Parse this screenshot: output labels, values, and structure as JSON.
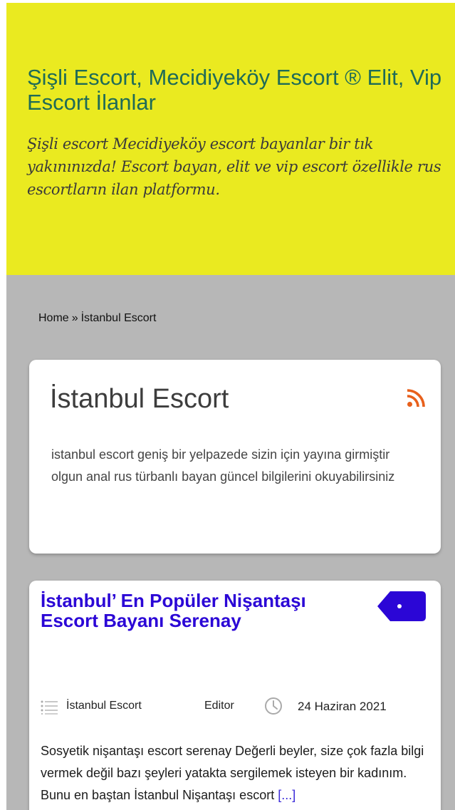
{
  "header": {
    "title": "Şişli Escort, Mecidiyeköy Escort ® Elit, Vip Escort İlanlar",
    "description": "Şişli escort Mecidiyeköy escort bayanlar bir tık yakınınızda! Escort bayan, elit ve vip escort özellikle rus escortların ilan platformu."
  },
  "breadcrumb": {
    "home": "Home",
    "separator": "»",
    "current": "İstanbul Escort"
  },
  "category": {
    "title": "İstanbul Escort",
    "description": "istanbul escort geniş bir yelpazede sizin için yayına girmiştir olgun anal rus türbanlı bayan güncel bilgilerini okuyabilirsiniz",
    "feed_icon": "rss-icon"
  },
  "post": {
    "title": "İstanbul’ En Popüler Nişantaşı Escort Bayanı Serenay",
    "category": "İstanbul Escort",
    "author": "Editor",
    "date": "24 Haziran 2021",
    "excerpt": "Sosyetik nişantaşı escort serenay Değerli beyler, size çok fazla bilgi vermek değil bazı şeyleri yatakta sergilemek isteyen bir kadınım. Bunu en baştan İstanbul Nişantaşı escort",
    "read_more": "[...]",
    "tag_icon": "tag-icon",
    "category_icon": "list-icon",
    "date_icon": "clock-icon"
  },
  "colors": {
    "header_bg": "#eaea20",
    "title_color": "#1f6b57",
    "page_bg": "#b7b7b7",
    "link_accent": "#2b06d6",
    "rss_orange": "#e8601c"
  }
}
